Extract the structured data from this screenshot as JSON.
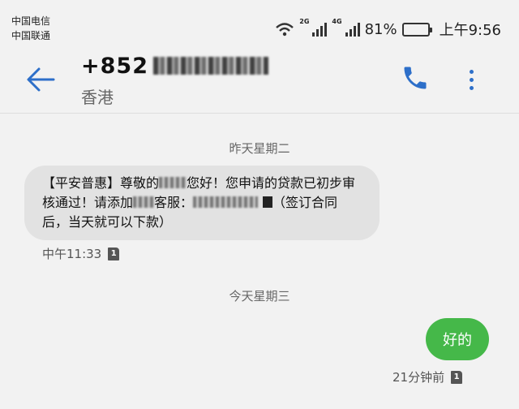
{
  "status_bar": {
    "carriers": [
      "中国电信",
      "中国联通"
    ],
    "net_1": "2G",
    "net_2": "4G",
    "battery": "81%",
    "battery_level": 0.81,
    "time": "上午9:56"
  },
  "header": {
    "number_visible": "+852",
    "location": "香港"
  },
  "messages": {
    "date_yesterday": "昨天星期二",
    "incoming": {
      "part1": "【平安普惠】尊敬的",
      "part2": "您好！您申请的贷款已初步审核通过！请添加",
      "part3": "客服：",
      "part4": "（签订合同后，当天就可以下款）",
      "time": "中午11:33",
      "sim": "1"
    },
    "date_today": "今天星期三",
    "outgoing": {
      "text": "好的",
      "time": "21分钟前",
      "sim": "1"
    }
  },
  "icons": {
    "back": "back-arrow-icon",
    "call": "phone-icon",
    "more": "more-vertical-icon",
    "wifi": "wifi-icon",
    "signal": "signal-icon",
    "battery": "battery-icon",
    "sim": "sim-card-icon"
  },
  "colors": {
    "accent": "#2d6fc9",
    "outgoing_bubble": "#45b849",
    "incoming_bubble": "#e2e2e2"
  }
}
